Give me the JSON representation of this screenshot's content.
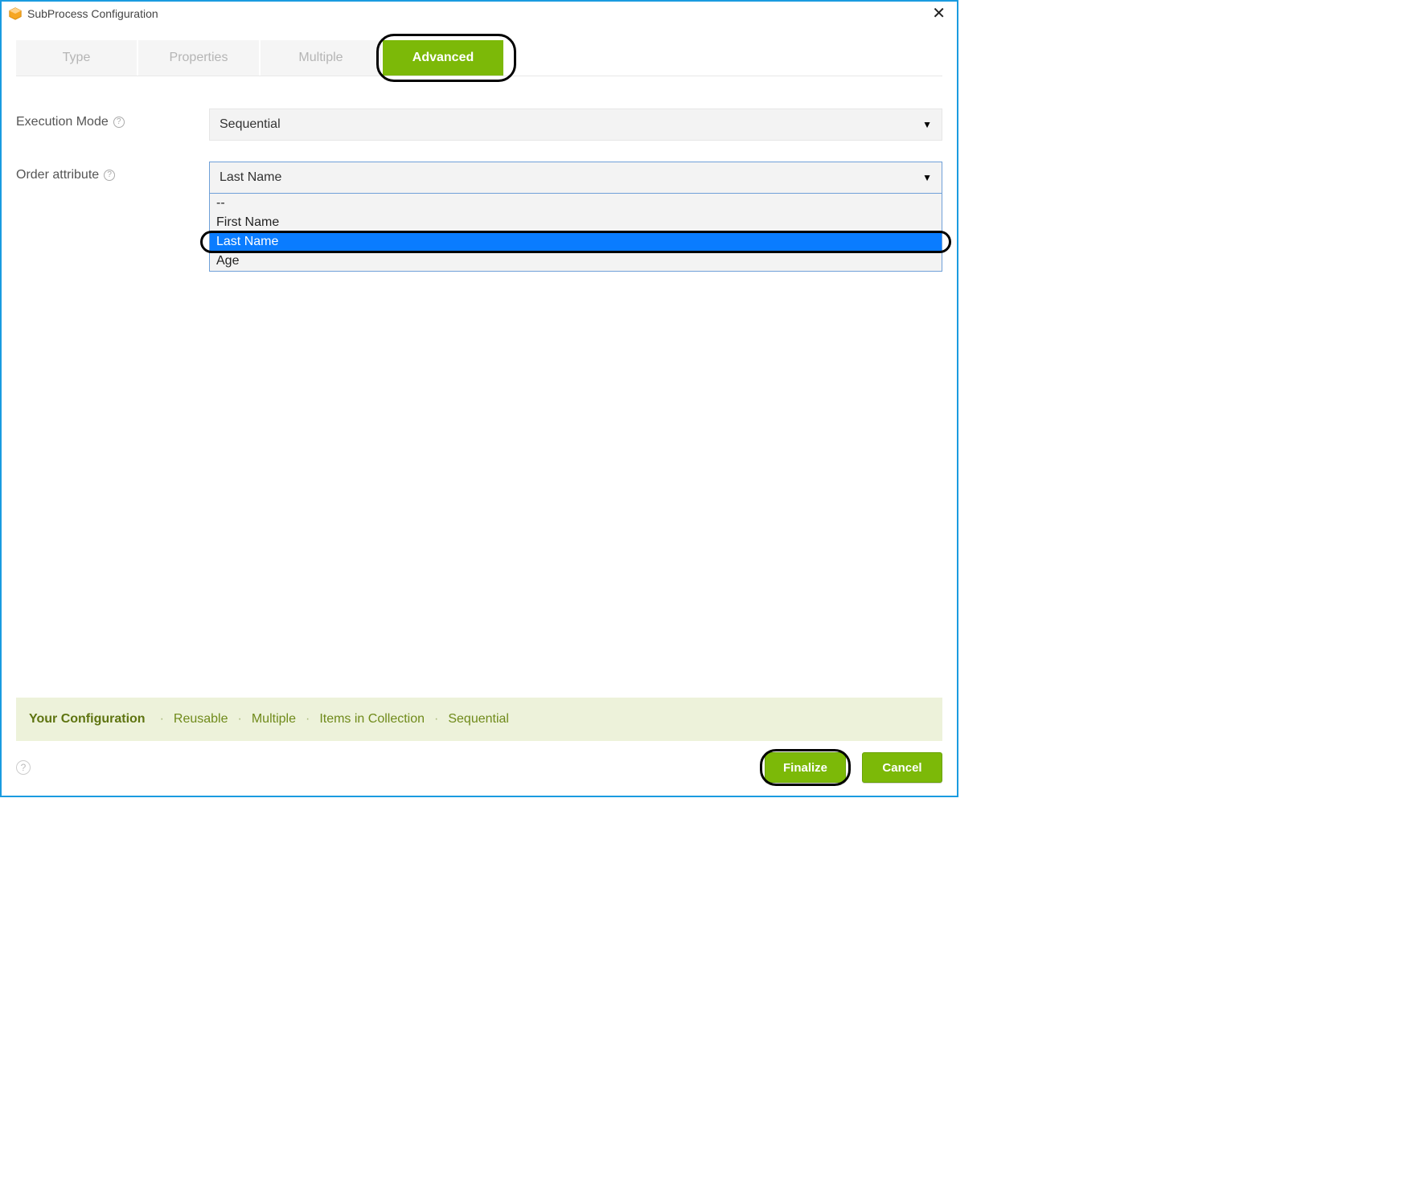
{
  "window": {
    "title": "SubProcess Configuration"
  },
  "tabs": [
    {
      "label": "Type",
      "active": false
    },
    {
      "label": "Properties",
      "active": false
    },
    {
      "label": "Multiple",
      "active": false
    },
    {
      "label": "Advanced",
      "active": true
    }
  ],
  "fields": {
    "executionMode": {
      "label": "Execution Mode",
      "value": "Sequential"
    },
    "orderAttribute": {
      "label": "Order attribute",
      "value": "Last Name",
      "options": [
        "--",
        "First Name",
        "Last Name",
        "Age"
      ],
      "selectedIndex": 2
    }
  },
  "configBar": {
    "label": "Your Configuration",
    "items": [
      "Reusable",
      "Multiple",
      "Items in Collection",
      "Sequential"
    ]
  },
  "buttons": {
    "finalize": "Finalize",
    "cancel": "Cancel"
  },
  "colors": {
    "accent": "#7cb908",
    "highlightBlue": "#0a7cff",
    "windowBorder": "#1a9be0"
  }
}
